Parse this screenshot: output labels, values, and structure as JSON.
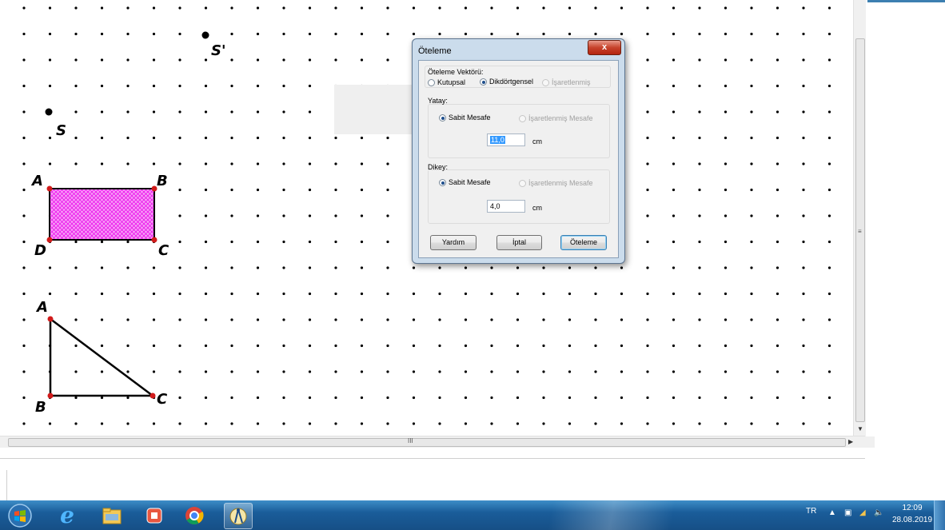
{
  "canvas": {
    "labels": {
      "s_prime": "S'",
      "s": "S",
      "rect_a": "A",
      "rect_b": "B",
      "rect_c": "C",
      "rect_d": "D",
      "tri_a": "A",
      "tri_b": "B",
      "tri_c": "C"
    },
    "colors": {
      "grid_dot": "#000000",
      "vertex": "#d11a1a",
      "fill_hatch": "#ee22ee",
      "edge": "#000000"
    }
  },
  "dialog": {
    "title": "Öteleme",
    "close_glyph": "x",
    "vector_group": "Öteleme Vektörü:",
    "polar": "Kutupsal",
    "rectangular": "Dikdörtgensel",
    "marked": "İşaretlenmiş",
    "horizontal": {
      "group": "Yatay:",
      "fixed": "Sabit Mesafe",
      "marked": "İşaretlenmiş Mesafe",
      "value": "11,0",
      "unit": "cm"
    },
    "vertical": {
      "group": "Dikey:",
      "fixed": "Sabit Mesafe",
      "marked": "İşaretlenmiş Mesafe",
      "value": "4,0",
      "unit": "cm"
    },
    "buttons": {
      "help": "Yardım",
      "cancel": "İptal",
      "ok": "Öteleme"
    }
  },
  "scrollbars": {
    "grip": "III"
  },
  "taskbar": {
    "icons": [
      "start-orb-icon",
      "internet-explorer-icon",
      "file-explorer-icon",
      "media-player-icon",
      "chrome-icon",
      "geometers-sketchpad-icon"
    ],
    "lang": "TR",
    "time": "12:09",
    "date": "28.08.2019"
  }
}
